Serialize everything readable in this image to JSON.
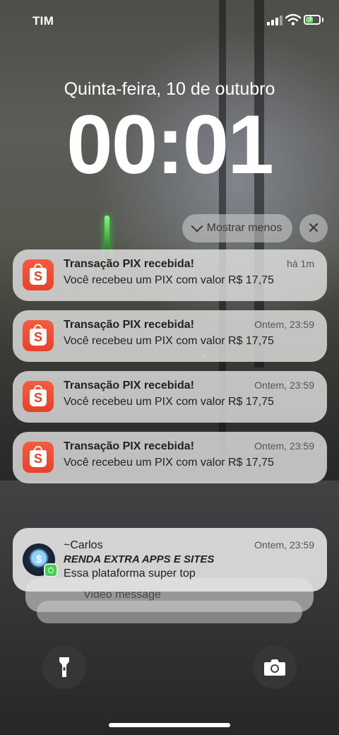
{
  "status_bar": {
    "carrier": "TIM",
    "battery_color": "#5fe36a"
  },
  "lock_screen": {
    "date": "Quinta-feira, 10 de outubro",
    "time": "00:01"
  },
  "group_controls": {
    "show_less_label": "Mostrar menos",
    "clear_label": "✕"
  },
  "notifications": [
    {
      "app_icon": "shopee-bag-icon",
      "title": "Transação PIX recebida!",
      "body": "Você recebeu um PIX com valor R$ 17,75",
      "time": "há 1m"
    },
    {
      "app_icon": "shopee-bag-icon",
      "title": "Transação PIX recebida!",
      "body": "Você recebeu um PIX com valor R$ 17,75",
      "time": "Ontem, 23:59"
    },
    {
      "app_icon": "shopee-bag-icon",
      "title": "Transação PIX recebida!",
      "body": "Você recebeu um PIX com valor R$ 17,75",
      "time": "Ontem, 23:59"
    },
    {
      "app_icon": "shopee-bag-icon",
      "title": "Transação PIX recebida!",
      "body": "Você recebeu um PIX com valor R$ 17,75",
      "time": "Ontem, 23:59"
    }
  ],
  "message_notification": {
    "sender": "~Carlos",
    "subtitle": "RENDA EXTRA APPS E SITES",
    "body": "Essa plataforma super top",
    "time": "Ontem, 23:59",
    "badge_icon": "whatsapp-icon",
    "avatar_glyph": "$"
  },
  "stacked_preview": {
    "text": "Video message"
  },
  "bottom_controls": {
    "left": "flashlight-icon",
    "right": "camera-icon"
  },
  "accent_colors": {
    "shopee": "#ee4d2d",
    "whatsapp": "#3fd24a"
  }
}
